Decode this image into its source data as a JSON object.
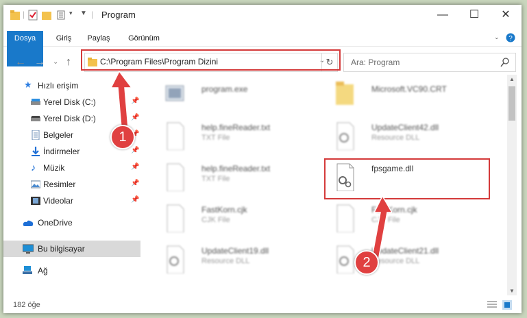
{
  "window": {
    "title": "Program",
    "controls": {
      "minimize": "—",
      "maximize": "☐",
      "close": "✕"
    }
  },
  "ribbon": {
    "tabs": [
      "Dosya",
      "Giriş",
      "Paylaş",
      "Görünüm"
    ]
  },
  "address": {
    "path": "C:\\Program Files\\Program Dizini",
    "search_placeholder": "Ara: Program"
  },
  "nav": {
    "items": [
      {
        "label": "Hızlı erişim",
        "icon": "star-icon"
      },
      {
        "label": "Yerel Disk (C:)",
        "icon": "drive-icon",
        "pinned": true
      },
      {
        "label": "Yerel Disk (D:)",
        "icon": "drive-icon",
        "pinned": true
      },
      {
        "label": "Belgeler",
        "icon": "documents-icon",
        "pinned": true
      },
      {
        "label": "İndirmeler",
        "icon": "download-icon",
        "pinned": true
      },
      {
        "label": "Müzik",
        "icon": "music-icon",
        "pinned": true
      },
      {
        "label": "Resimler",
        "icon": "pictures-icon",
        "pinned": true
      },
      {
        "label": "Videolar",
        "icon": "videos-icon",
        "pinned": true
      },
      {
        "label": "OneDrive",
        "icon": "cloud-icon"
      },
      {
        "label": "Bu bilgisayar",
        "icon": "computer-icon",
        "selected": true
      },
      {
        "label": "Ağ",
        "icon": "network-icon"
      }
    ]
  },
  "files": [
    {
      "name": "program.exe",
      "type": ""
    },
    {
      "name": "Microsoft.VC90.CRT",
      "type": ""
    },
    {
      "name": "help.fineReader.txt",
      "type": "TXT File"
    },
    {
      "name": "UpdateClient42.dll",
      "type": "Resource DLL"
    },
    {
      "name": "help.fineReader.txt",
      "type": "TXT File"
    },
    {
      "name": "fpsgame.dll",
      "type": ""
    },
    {
      "name": "FastKorn.cjk",
      "type": "CJK File"
    },
    {
      "name": "FastKorn.cjk",
      "type": "CJK File"
    },
    {
      "name": "UpdateClient19.dll",
      "type": "Resource DLL"
    },
    {
      "name": "UpdateClient21.dll",
      "type": "Resource DLL"
    }
  ],
  "status": {
    "count": "182 öğe"
  },
  "annotations": {
    "step1": "1",
    "step2": "2"
  },
  "colors": {
    "accent": "#1979ca",
    "highlight": "#d43a3a"
  }
}
